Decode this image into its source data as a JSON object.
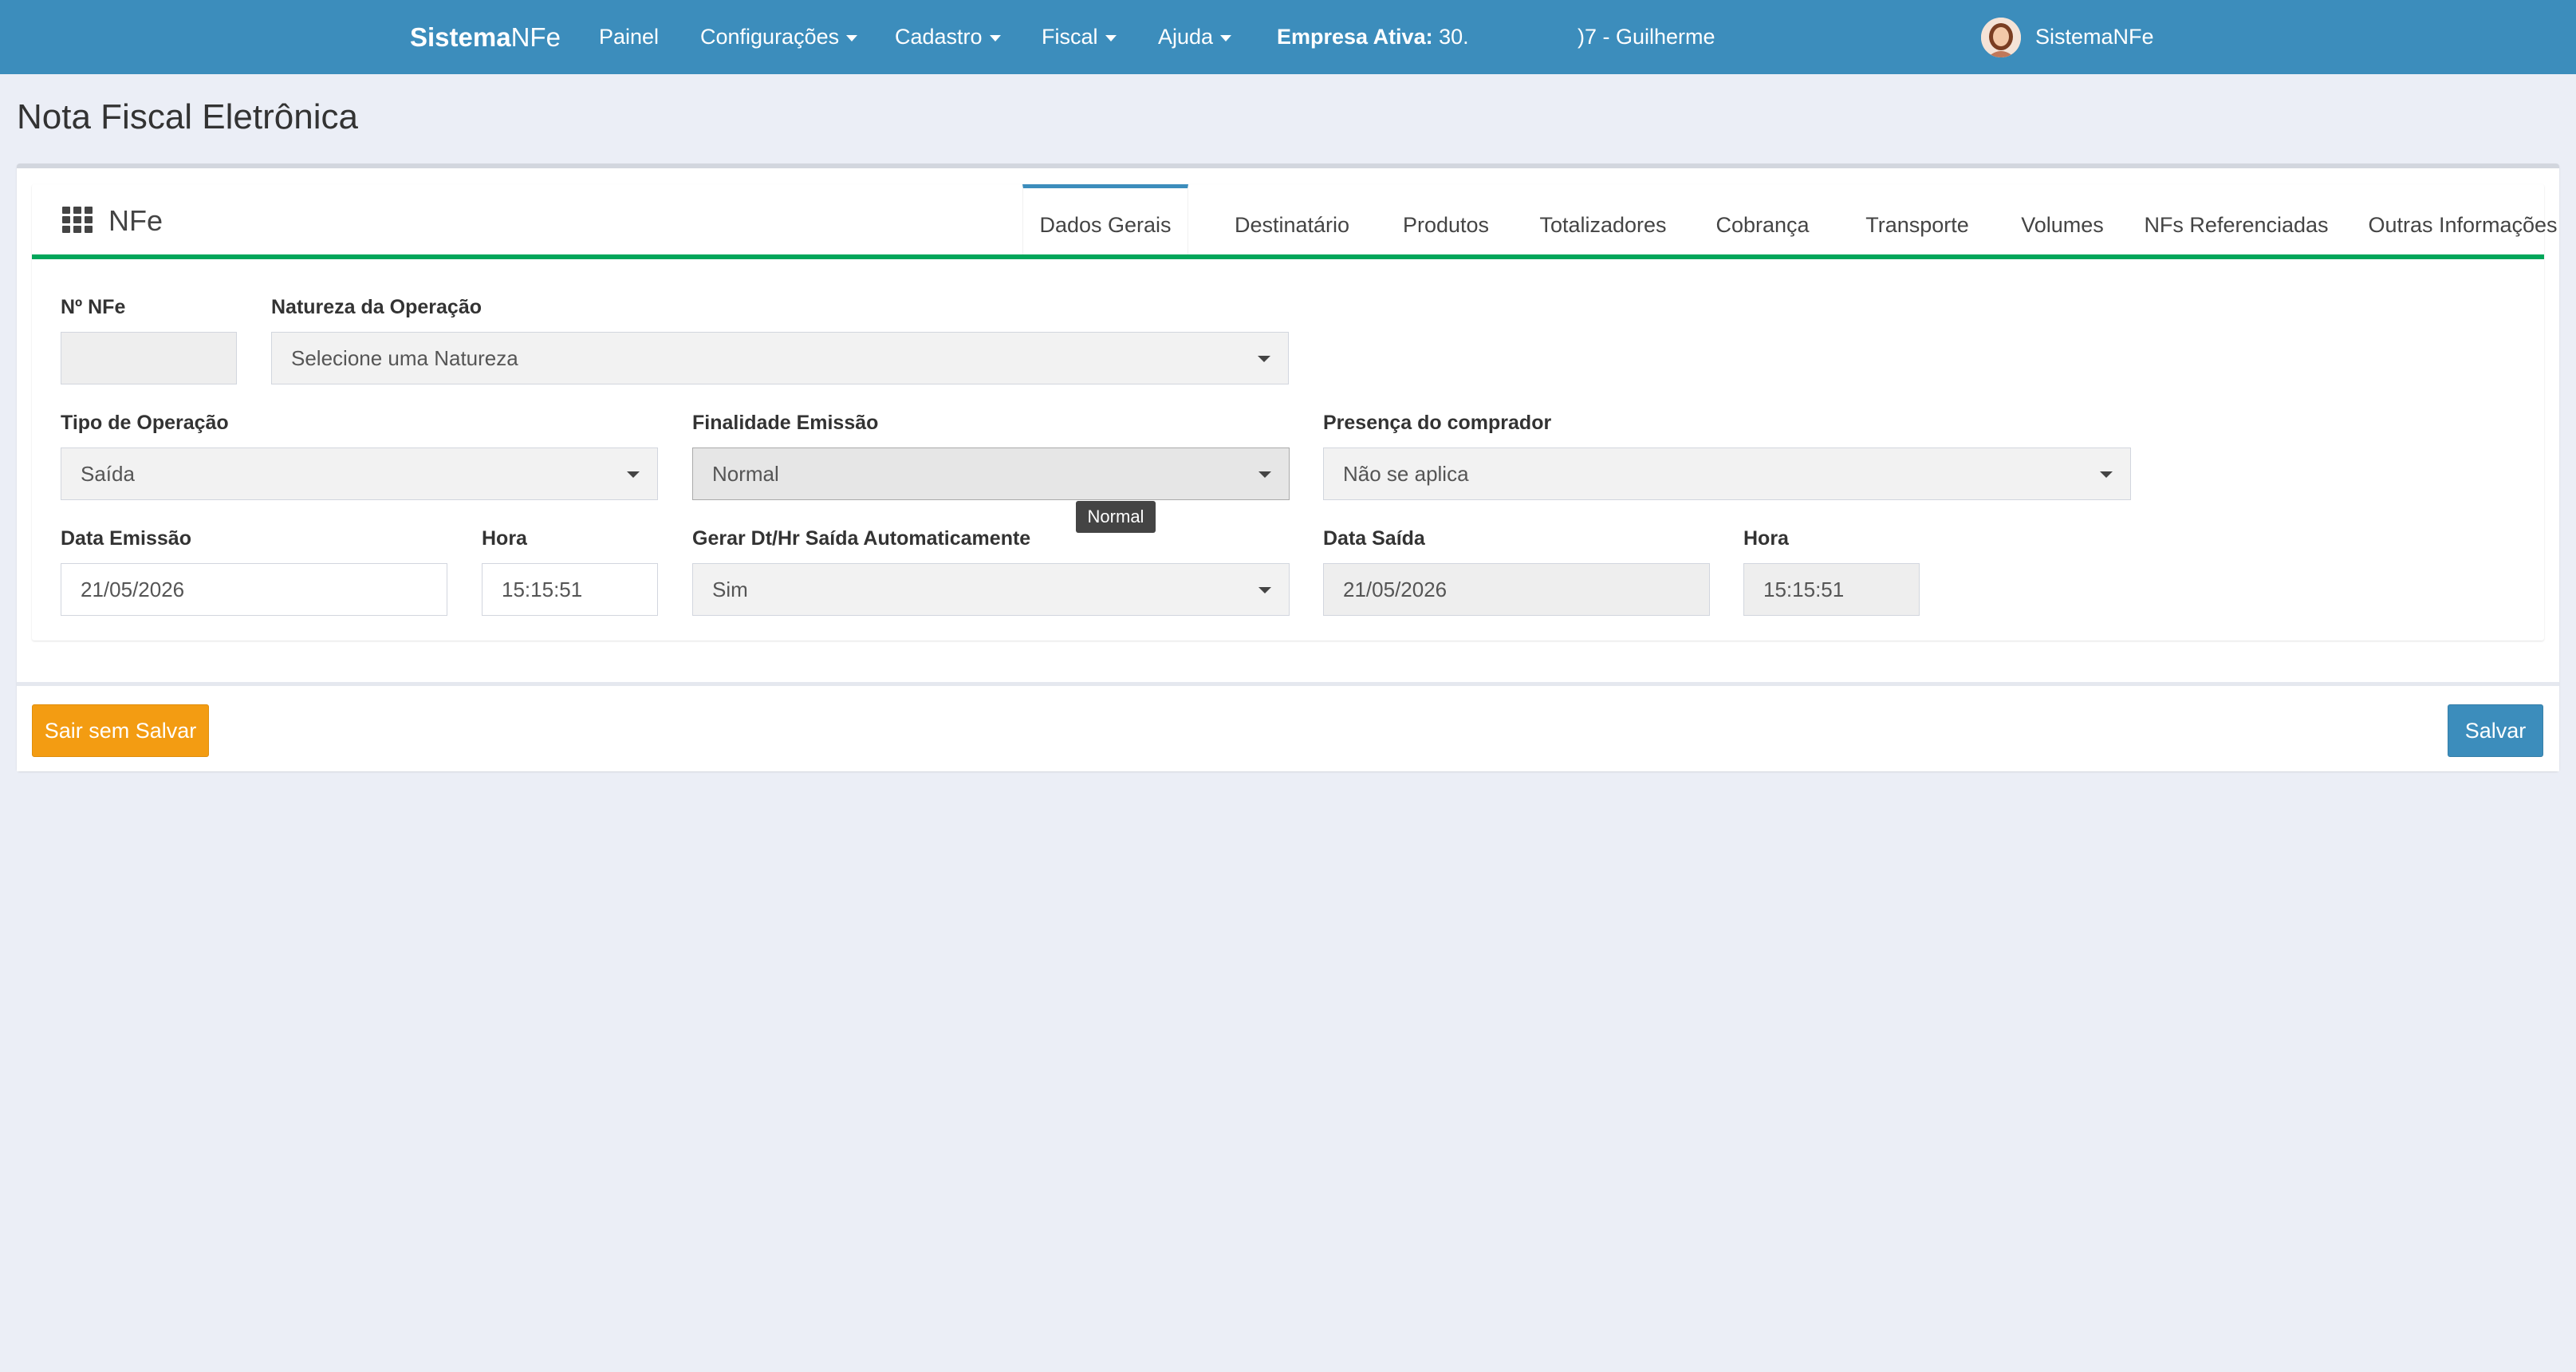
{
  "navbar": {
    "brand_bold": "Sistema",
    "brand_light": "NFe",
    "menu": [
      {
        "label": "Painel"
      },
      {
        "label": "Configurações"
      },
      {
        "label": "Cadastro"
      },
      {
        "label": "Fiscal"
      },
      {
        "label": "Ajuda"
      }
    ],
    "empresa_label": "Empresa Ativa:",
    "empresa_value_start": "30.",
    "empresa_value_end": ")7 - Guilherme",
    "user_name": "SistemaNFe"
  },
  "page": {
    "title": "Nota Fiscal Eletrônica"
  },
  "panel": {
    "title": "NFe",
    "tabs": [
      {
        "label": "Dados Gerais"
      },
      {
        "label": "Destinatário"
      },
      {
        "label": "Produtos"
      },
      {
        "label": "Totalizadores"
      },
      {
        "label": "Cobrança"
      },
      {
        "label": "Transporte"
      },
      {
        "label": "Volumes"
      },
      {
        "label": "NFs Referenciadas"
      },
      {
        "label": "Outras Informações"
      }
    ],
    "active_tab": "Dados Gerais"
  },
  "form": {
    "numero_nfe": {
      "label": "Nº NFe",
      "value": ""
    },
    "natureza": {
      "label": "Natureza da Operação",
      "value": "Selecione uma Natureza"
    },
    "tipo_operacao": {
      "label": "Tipo de Operação",
      "value": "Saída"
    },
    "finalidade": {
      "label": "Finalidade Emissão",
      "value": "Normal",
      "tooltip": "Normal"
    },
    "presenca": {
      "label": "Presença do comprador",
      "value": "Não se aplica"
    },
    "data_emissao": {
      "label": "Data Emissão",
      "value": "21/05/2026"
    },
    "hora_emissao": {
      "label": "Hora",
      "value": "15:15:51"
    },
    "gerar_saida": {
      "label": "Gerar Dt/Hr Saída Automaticamente",
      "value": "Sim"
    },
    "data_saida": {
      "label": "Data Saída",
      "value": "21/05/2026"
    },
    "hora_saida": {
      "label": "Hora",
      "value": "15:15:51"
    }
  },
  "footer": {
    "exit_label": "Sair sem Salvar",
    "save_label": "Salvar"
  },
  "colors": {
    "navbar": "#3c8dbc",
    "tab_underline": "#00a65a",
    "warning": "#f39c12",
    "primary": "#3c8dbc"
  }
}
